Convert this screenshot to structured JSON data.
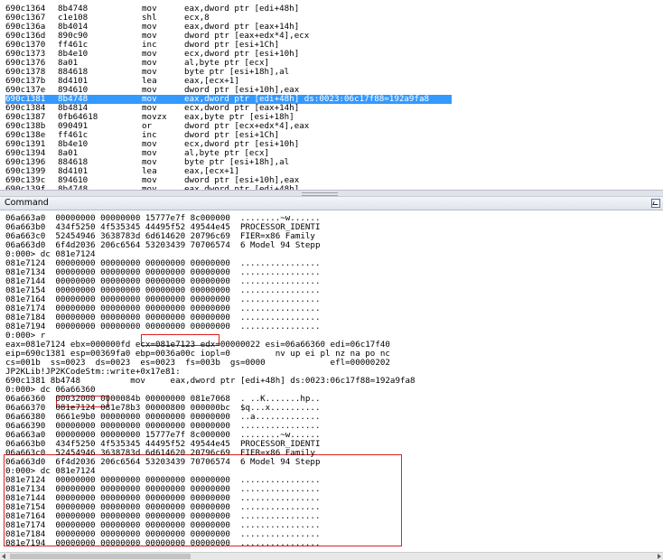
{
  "disassembly": {
    "rows": [
      {
        "addr": "690c1364",
        "bytes": "8b4748",
        "mnem": "mov",
        "ops": "eax,dword ptr [edi+48h]",
        "highlight": false
      },
      {
        "addr": "690c1367",
        "bytes": "c1e108",
        "mnem": "shl",
        "ops": "ecx,8",
        "highlight": false
      },
      {
        "addr": "690c136a",
        "bytes": "8b4014",
        "mnem": "mov",
        "ops": "eax,dword ptr [eax+14h]",
        "highlight": false
      },
      {
        "addr": "690c136d",
        "bytes": "890c90",
        "mnem": "mov",
        "ops": "dword ptr [eax+edx*4],ecx",
        "highlight": false
      },
      {
        "addr": "690c1370",
        "bytes": "ff461c",
        "mnem": "inc",
        "ops": "dword ptr [esi+1Ch]",
        "highlight": false
      },
      {
        "addr": "690c1373",
        "bytes": "8b4e10",
        "mnem": "mov",
        "ops": "ecx,dword ptr [esi+10h]",
        "highlight": false
      },
      {
        "addr": "690c1376",
        "bytes": "8a01",
        "mnem": "mov",
        "ops": "al,byte ptr [ecx]",
        "highlight": false
      },
      {
        "addr": "690c1378",
        "bytes": "884618",
        "mnem": "mov",
        "ops": "byte ptr [esi+18h],al",
        "highlight": false
      },
      {
        "addr": "690c137b",
        "bytes": "8d4101",
        "mnem": "lea",
        "ops": "eax,[ecx+1]",
        "highlight": false
      },
      {
        "addr": "690c137e",
        "bytes": "894610",
        "mnem": "mov",
        "ops": "dword ptr [esi+10h],eax",
        "highlight": false
      },
      {
        "addr": "690c1381",
        "bytes": "8b4748",
        "mnem": "mov",
        "ops": "eax,dword ptr [edi+48h] ds:0023:06c17f88=192a9fa8",
        "highlight": true
      },
      {
        "addr": "690c1384",
        "bytes": "8b4814",
        "mnem": "mov",
        "ops": "ecx,dword ptr [eax+14h]",
        "highlight": false
      },
      {
        "addr": "690c1387",
        "bytes": "0fb64618",
        "mnem": "movzx",
        "ops": "eax,byte ptr [esi+18h]",
        "highlight": false
      },
      {
        "addr": "690c138b",
        "bytes": "090491",
        "mnem": "or",
        "ops": "dword ptr [ecx+edx*4],eax",
        "highlight": false
      },
      {
        "addr": "690c138e",
        "bytes": "ff461c",
        "mnem": "inc",
        "ops": "dword ptr [esi+1Ch]",
        "highlight": false
      },
      {
        "addr": "690c1391",
        "bytes": "8b4e10",
        "mnem": "mov",
        "ops": "ecx,dword ptr [esi+10h]",
        "highlight": false
      },
      {
        "addr": "690c1394",
        "bytes": "8a01",
        "mnem": "mov",
        "ops": "al,byte ptr [ecx]",
        "highlight": false
      },
      {
        "addr": "690c1396",
        "bytes": "884618",
        "mnem": "mov",
        "ops": "byte ptr [esi+18h],al",
        "highlight": false
      },
      {
        "addr": "690c1399",
        "bytes": "8d4101",
        "mnem": "lea",
        "ops": "eax,[ecx+1]",
        "highlight": false
      },
      {
        "addr": "690c139c",
        "bytes": "894610",
        "mnem": "mov",
        "ops": "dword ptr [esi+10h],eax",
        "highlight": false
      },
      {
        "addr": "690c139f",
        "bytes": "8b4748",
        "mnem": "mov",
        "ops": "eax,dword ptr [edi+48h]",
        "highlight": false
      }
    ]
  },
  "command": {
    "title": "Command",
    "lines": [
      "06a663a0  00000000 00000000 15777e7f 8c000000  ........~w......",
      "06a663b0  434f5250 4f535345 44495f52 49544e45  PROCESSOR_IDENTI",
      "06a663c0  52454946 3638783d 6d614620 20796c69  FIER=x86 Family",
      "06a663d0  6f4d2036 206c6564 53203439 70706574  6 Model 94 Stepp",
      "0:000> dc 081e7124",
      "081e7124  00000000 00000000 00000000 00000000  ................",
      "081e7134  00000000 00000000 00000000 00000000  ................",
      "081e7144  00000000 00000000 00000000 00000000  ................",
      "081e7154  00000000 00000000 00000000 00000000  ................",
      "081e7164  00000000 00000000 00000000 00000000  ................",
      "081e7174  00000000 00000000 00000000 00000000  ................",
      "081e7184  00000000 00000000 00000000 00000000  ................",
      "081e7194  00000000 00000000 00000000 00000000  ................",
      "0:000> r",
      "eax=081e7124 ebx=000000fd ecx=081e7123 edx=00000022 esi=06a66360 edi=06c17f40",
      "eip=690c1381 esp=00369fa0 ebp=0036a00c iopl=0         nv up ei pl nz na po nc",
      "cs=001b  ss=0023  ds=0023  es=0023  fs=003b  gs=0000             efl=00000202",
      "JP2KLib!JP2KCodeStm::write+0x17e81:",
      "690c1381 8b4748          mov     eax,dword ptr [edi+48h] ds:0023:06c17f88=192a9fa8",
      "0:000> dc 06a66360",
      "06a66360  00032000 0000084b 00000000 081e7068  . ..K.......hp..",
      "06a66370  081e7124 081e78b3 00000800 000000bc  $q...x..........",
      "06a66380  0661e9b0 00000000 00000000 00000000  ..a.............",
      "06a66390  00000000 00000000 00000000 00000000  ................",
      "06a663a0  00000000 00000000 15777e7f 8c000000  ........~w......",
      "06a663b0  434f5250 4f535345 44495f52 49544e45  PROCESSOR_IDENTI",
      "06a663c0  52454946 3638783d 6d614620 20796c69  FIER=x86 Family",
      "06a663d0  6f4d2036 206c6564 53203439 70706574  6 Model 94 Stepp",
      "0:000> dc 081e7124",
      "081e7124  00000000 00000000 00000000 00000000  ................",
      "081e7134  00000000 00000000 00000000 00000000  ................",
      "081e7144  00000000 00000000 00000000 00000000  ................",
      "081e7154  00000000 00000000 00000000 00000000  ................",
      "081e7164  00000000 00000000 00000000 00000000  ................",
      "081e7174  00000000 00000000 00000000 00000000  ................",
      "081e7184  00000000 00000000 00000000 00000000  ................",
      "081e7194  00000000 00000000 00000000 00000000  ................"
    ]
  },
  "colors": {
    "highlight": "#3399ff",
    "annotation": "#e02020"
  }
}
